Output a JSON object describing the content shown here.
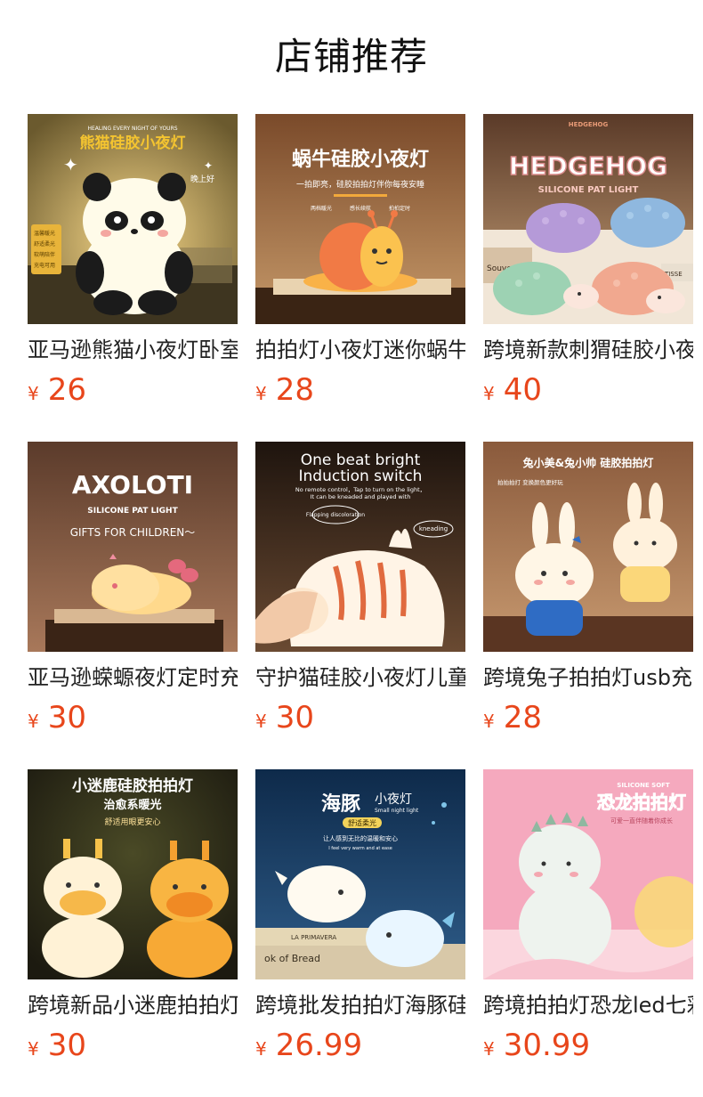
{
  "header": {
    "title": "店铺推荐"
  },
  "currency": "¥",
  "products": [
    {
      "name": "亚马逊熊猫小夜灯卧室",
      "price": "26",
      "image_texts": [
        "HEALING EVERY NIGHT OF YOURS",
        "熊猫硅胶小夜灯",
        "晚上好",
        "温馨暖光",
        "舒适柔光",
        "软萌陪伴",
        "充电可用"
      ]
    },
    {
      "name": "拍拍灯小夜灯迷你蜗牛",
      "price": "28",
      "image_texts": [
        "蜗牛硅胶小夜灯",
        "一拍即亮，硅胶拍拍灯伴你每夜安睡",
        "两档暖光",
        "感长续航",
        "拍拍定时"
      ]
    },
    {
      "name": "跨境新款刺猬硅胶小夜灯",
      "price": "40",
      "image_texts": [
        "HEDGEHOG",
        "HEDGEHOG",
        "SILICONE PAT LIGHT",
        "Souvenirs",
        "TISSE"
      ]
    },
    {
      "name": "亚马逊蝾螈夜灯定时充电",
      "price": "30",
      "image_texts": [
        "AXOLOTI",
        "SILICONE PAT LIGHT",
        "GIFTS FOR CHILDREN～"
      ]
    },
    {
      "name": "守护猫硅胶小夜灯儿童",
      "price": "30",
      "image_texts": [
        "One beat bright",
        "Induction switch",
        "No remote control，Tap to turn on the light，",
        "It can be kneaded and played with",
        "Flapping discoloration",
        "kneading"
      ]
    },
    {
      "name": "跨境兔子拍拍灯usb充电",
      "price": "28",
      "image_texts": [
        "兔小美&兔小帅 硅胶拍拍灯",
        "拍拍拍打 变换颜色更好玩"
      ]
    },
    {
      "name": "跨境新品小迷鹿拍拍灯",
      "price": "30",
      "image_texts": [
        "小迷鹿硅胶拍拍灯",
        "治愈系暖光",
        "舒适用眼更安心"
      ]
    },
    {
      "name": "跨境批发拍拍灯海豚硅胶",
      "price": "26.99",
      "image_texts": [
        "海豚",
        "小夜灯",
        "Small night light",
        "舒适柔光",
        "让人感到无比的温暖和安心",
        "I feel very warm and at ease",
        "LA PRIMAVERA",
        "ok of Bread"
      ]
    },
    {
      "name": "跨境拍拍灯恐龙led七彩",
      "price": "30.99",
      "image_texts": [
        "SILICONE SOFT",
        "恐龙拍拍灯",
        "可爱一直伴随着你成长"
      ]
    }
  ]
}
